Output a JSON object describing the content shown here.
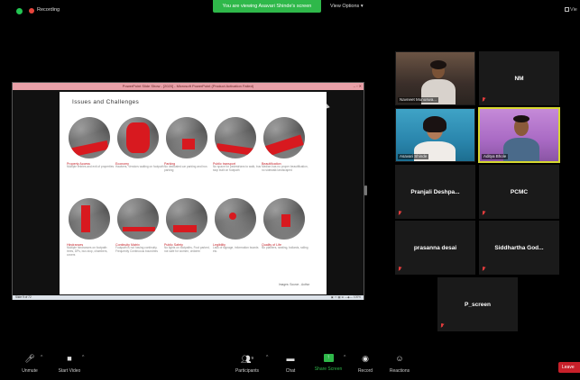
{
  "topbar": {
    "recording_label": "Recording",
    "viewing_banner": "You are viewing Asavari Shinde's screen",
    "view_options_label": "View Options",
    "view_right_label": "Vie"
  },
  "ppt": {
    "window_title": "PowerPoint Slide Show - [2020] - Microsoft PowerPoint (Product Activation Failed)",
    "slide_title": "Issues and Challenges",
    "items": [
      {
        "title": "Property Access",
        "body": "Multiple entries and exit of properties"
      },
      {
        "title": "Economy",
        "body": "Hawkers, Vendors waiting on footpath"
      },
      {
        "title": "Parking",
        "body": "No dedicated car parking and bus parking"
      },
      {
        "title": "Public transport",
        "body": "No space for pedestrians to walk, bus stop built on footpath"
      },
      {
        "title": "Beautification",
        "body": "Median has no proper beautification, no sidewalk landscaped"
      },
      {
        "title": "Hindrances",
        "body": "Multiple hindrances on footpath: trees, DPs, bus stop, chambers, covers"
      },
      {
        "title": "Continuity Matrix",
        "body": "Footpath is not having continuity, Frequently Continuous boundries"
      },
      {
        "title": "Public Safety",
        "body": "No lights on footpaths, Foot parked, not safe for women, children"
      },
      {
        "title": "Legibility",
        "body": "Lack of signage, information boards etc."
      },
      {
        "title": "Quality of Life",
        "body": "No planters, seating, bollards, railing"
      }
    ],
    "credit": "Images: Source - Author",
    "status_left": "Slide 9 of 72",
    "status_right": "▣ ▭ ▦ ⊞  —◆— 100%"
  },
  "participants": [
    {
      "name": "Navneet Munuswa...",
      "kind": "video"
    },
    {
      "name": "NM",
      "kind": "name"
    },
    {
      "name": "Asavari Shinde",
      "kind": "video"
    },
    {
      "name": "Aditya Bhole",
      "kind": "video"
    },
    {
      "name": "Pranjali  Deshpa...",
      "kind": "name"
    },
    {
      "name": "PCMC",
      "kind": "name"
    },
    {
      "name": "prasanna desai",
      "kind": "name"
    },
    {
      "name": "Siddhartha  God...",
      "kind": "name"
    },
    {
      "name": "P_screen",
      "kind": "name"
    }
  ],
  "toolbar": {
    "unmute": "Unmute",
    "start_video": "Start Video",
    "participants": "Participants",
    "participants_count": "9",
    "chat": "Chat",
    "share_screen": "Share Screen",
    "record": "Record",
    "reactions": "Reactions",
    "leave": "Leave"
  },
  "colors": {
    "share_green": "#2fb84a",
    "leave_red": "#c8202a",
    "active_speaker": "#d6d82f",
    "slide_accent_red": "#d8191f"
  }
}
